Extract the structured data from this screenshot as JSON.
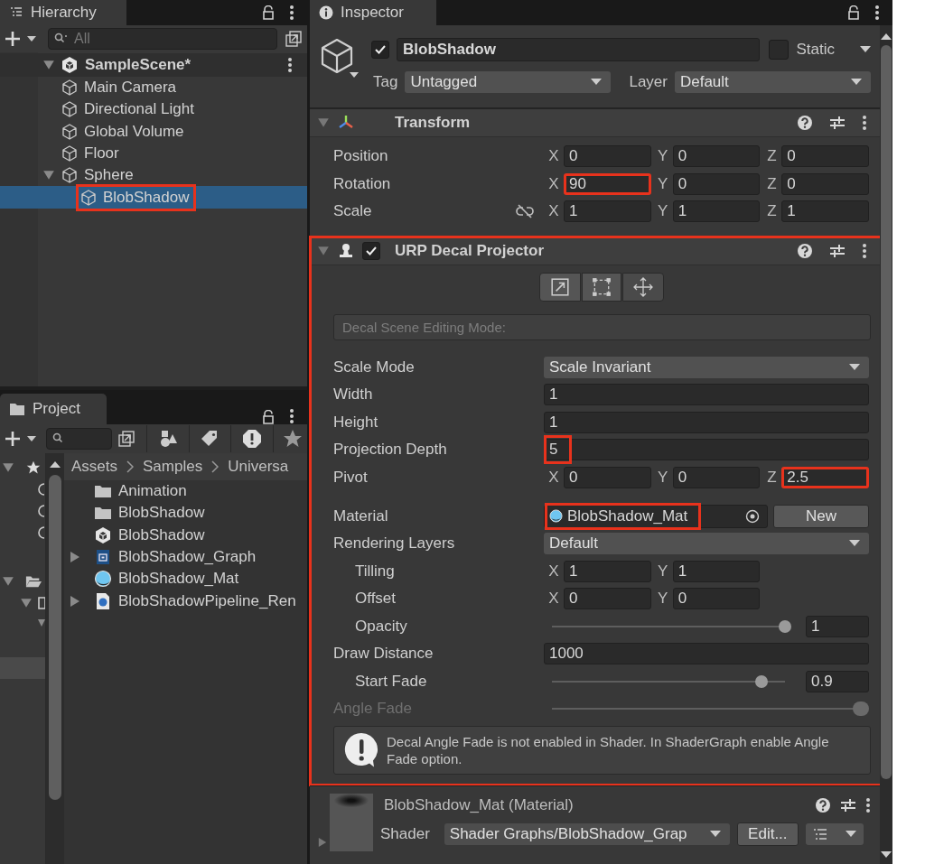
{
  "hierarchy": {
    "title": "Hierarchy",
    "search": {
      "placeholder": "All"
    },
    "scene": {
      "name": "SampleScene*",
      "expanded": true,
      "children": [
        {
          "name": "Main Camera",
          "selected": false,
          "highlighted": false
        },
        {
          "name": "Directional Light",
          "selected": false,
          "highlighted": false
        },
        {
          "name": "Global Volume",
          "selected": false,
          "highlighted": false
        },
        {
          "name": "Floor",
          "selected": false,
          "highlighted": false
        },
        {
          "name": "Sphere",
          "selected": false,
          "highlighted": false,
          "expanded": true,
          "children": [
            {
              "name": "BlobShadow",
              "selected": true,
              "highlighted": true
            }
          ]
        }
      ]
    }
  },
  "project": {
    "title": "Project",
    "breadcrumb": [
      "Assets",
      "Samples",
      "Universa"
    ],
    "items": [
      {
        "name": "Animation",
        "kind": "folder",
        "expandable": false
      },
      {
        "name": "BlobShadow",
        "kind": "folder",
        "expandable": false
      },
      {
        "name": "BlobShadow",
        "kind": "scene",
        "expandable": false
      },
      {
        "name": "BlobShadow_Graph",
        "kind": "shadergraph",
        "expandable": true
      },
      {
        "name": "BlobShadow_Mat",
        "kind": "material",
        "expandable": false
      },
      {
        "name": "BlobShadowPipeline_Ren",
        "kind": "pipeline",
        "expandable": true
      }
    ]
  },
  "inspector": {
    "title": "Inspector",
    "object": {
      "active": true,
      "name": "BlobShadow",
      "static": false,
      "static_label": "Static",
      "tag_label": "Tag",
      "tag": "Untagged",
      "layer_label": "Layer",
      "layer": "Default"
    },
    "components": [
      {
        "kind": "transform",
        "title": "Transform",
        "expanded": true,
        "rows": [
          {
            "kind": "vector",
            "label": "Position",
            "fields": [
              {
                "axis": "X",
                "value": "0",
                "highlighted": false
              },
              {
                "axis": "Y",
                "value": "0",
                "highlighted": false
              },
              {
                "axis": "Z",
                "value": "0",
                "highlighted": false
              }
            ]
          },
          {
            "kind": "vector",
            "label": "Rotation",
            "fields": [
              {
                "axis": "X",
                "value": "90",
                "highlighted": true
              },
              {
                "axis": "Y",
                "value": "0",
                "highlighted": false
              },
              {
                "axis": "Z",
                "value": "0",
                "highlighted": false
              }
            ]
          },
          {
            "kind": "vector",
            "label": "Scale",
            "proportional": false,
            "fields": [
              {
                "axis": "X",
                "value": "1",
                "highlighted": false
              },
              {
                "axis": "Y",
                "value": "1",
                "highlighted": false
              },
              {
                "axis": "Z",
                "value": "1",
                "highlighted": false
              }
            ]
          }
        ]
      },
      {
        "kind": "decal",
        "title": "URP Decal Projector",
        "expanded": true,
        "enabled": true,
        "highlighted": true,
        "editing_mode_label": "Decal Scene Editing Mode:",
        "rows": [
          {
            "kind": "dropdown",
            "label": "Scale Mode",
            "indent": false,
            "value": "Scale Invariant"
          },
          {
            "kind": "number",
            "label": "Width",
            "indent": false,
            "value": "1",
            "highlighted": false
          },
          {
            "kind": "number",
            "label": "Height",
            "indent": false,
            "value": "1",
            "highlighted": false
          },
          {
            "kind": "number",
            "label": "Projection Depth",
            "indent": false,
            "value": "5",
            "highlighted": true
          },
          {
            "kind": "vector",
            "label": "Pivot",
            "indent": false,
            "fields": [
              {
                "axis": "X",
                "value": "0",
                "highlighted": false
              },
              {
                "axis": "Y",
                "value": "0",
                "highlighted": false
              },
              {
                "axis": "Z",
                "value": "2.5",
                "highlighted": true
              }
            ]
          },
          {
            "kind": "object",
            "label": "Material",
            "indent": false,
            "value": "BlobShadow_Mat",
            "button": "New",
            "highlighted": true
          },
          {
            "kind": "dropdown",
            "label": "Rendering Layers",
            "indent": false,
            "value": "Default"
          },
          {
            "kind": "vector",
            "label": "Tilling",
            "indent": true,
            "fields": [
              {
                "axis": "X",
                "value": "1",
                "highlighted": false
              },
              {
                "axis": "Y",
                "value": "1",
                "highlighted": false
              }
            ]
          },
          {
            "kind": "vector",
            "label": "Offset",
            "indent": true,
            "fields": [
              {
                "axis": "X",
                "value": "0",
                "highlighted": false
              },
              {
                "axis": "Y",
                "value": "0",
                "highlighted": false
              }
            ]
          },
          {
            "kind": "slider",
            "label": "Opacity",
            "indent": true,
            "level": 1,
            "value": "1"
          },
          {
            "kind": "number",
            "label": "Draw Distance",
            "indent": false,
            "value": "1000",
            "highlighted": false
          },
          {
            "kind": "slider",
            "label": "Start Fade",
            "indent": true,
            "level": 0.9,
            "value": "0.9"
          },
          {
            "kind": "range",
            "label": "Angle Fade",
            "indent": false,
            "disabled": true,
            "level": 1
          }
        ],
        "help": "Decal Angle Fade is not enabled in Shader. In ShaderGraph enable Angle Fade option."
      },
      {
        "kind": "material",
        "title": "BlobShadow_Mat (Material)",
        "expanded": false,
        "shader_label": "Shader",
        "shader": "Shader Graphs/BlobShadow_Grap",
        "edit_button": "Edit..."
      }
    ]
  }
}
